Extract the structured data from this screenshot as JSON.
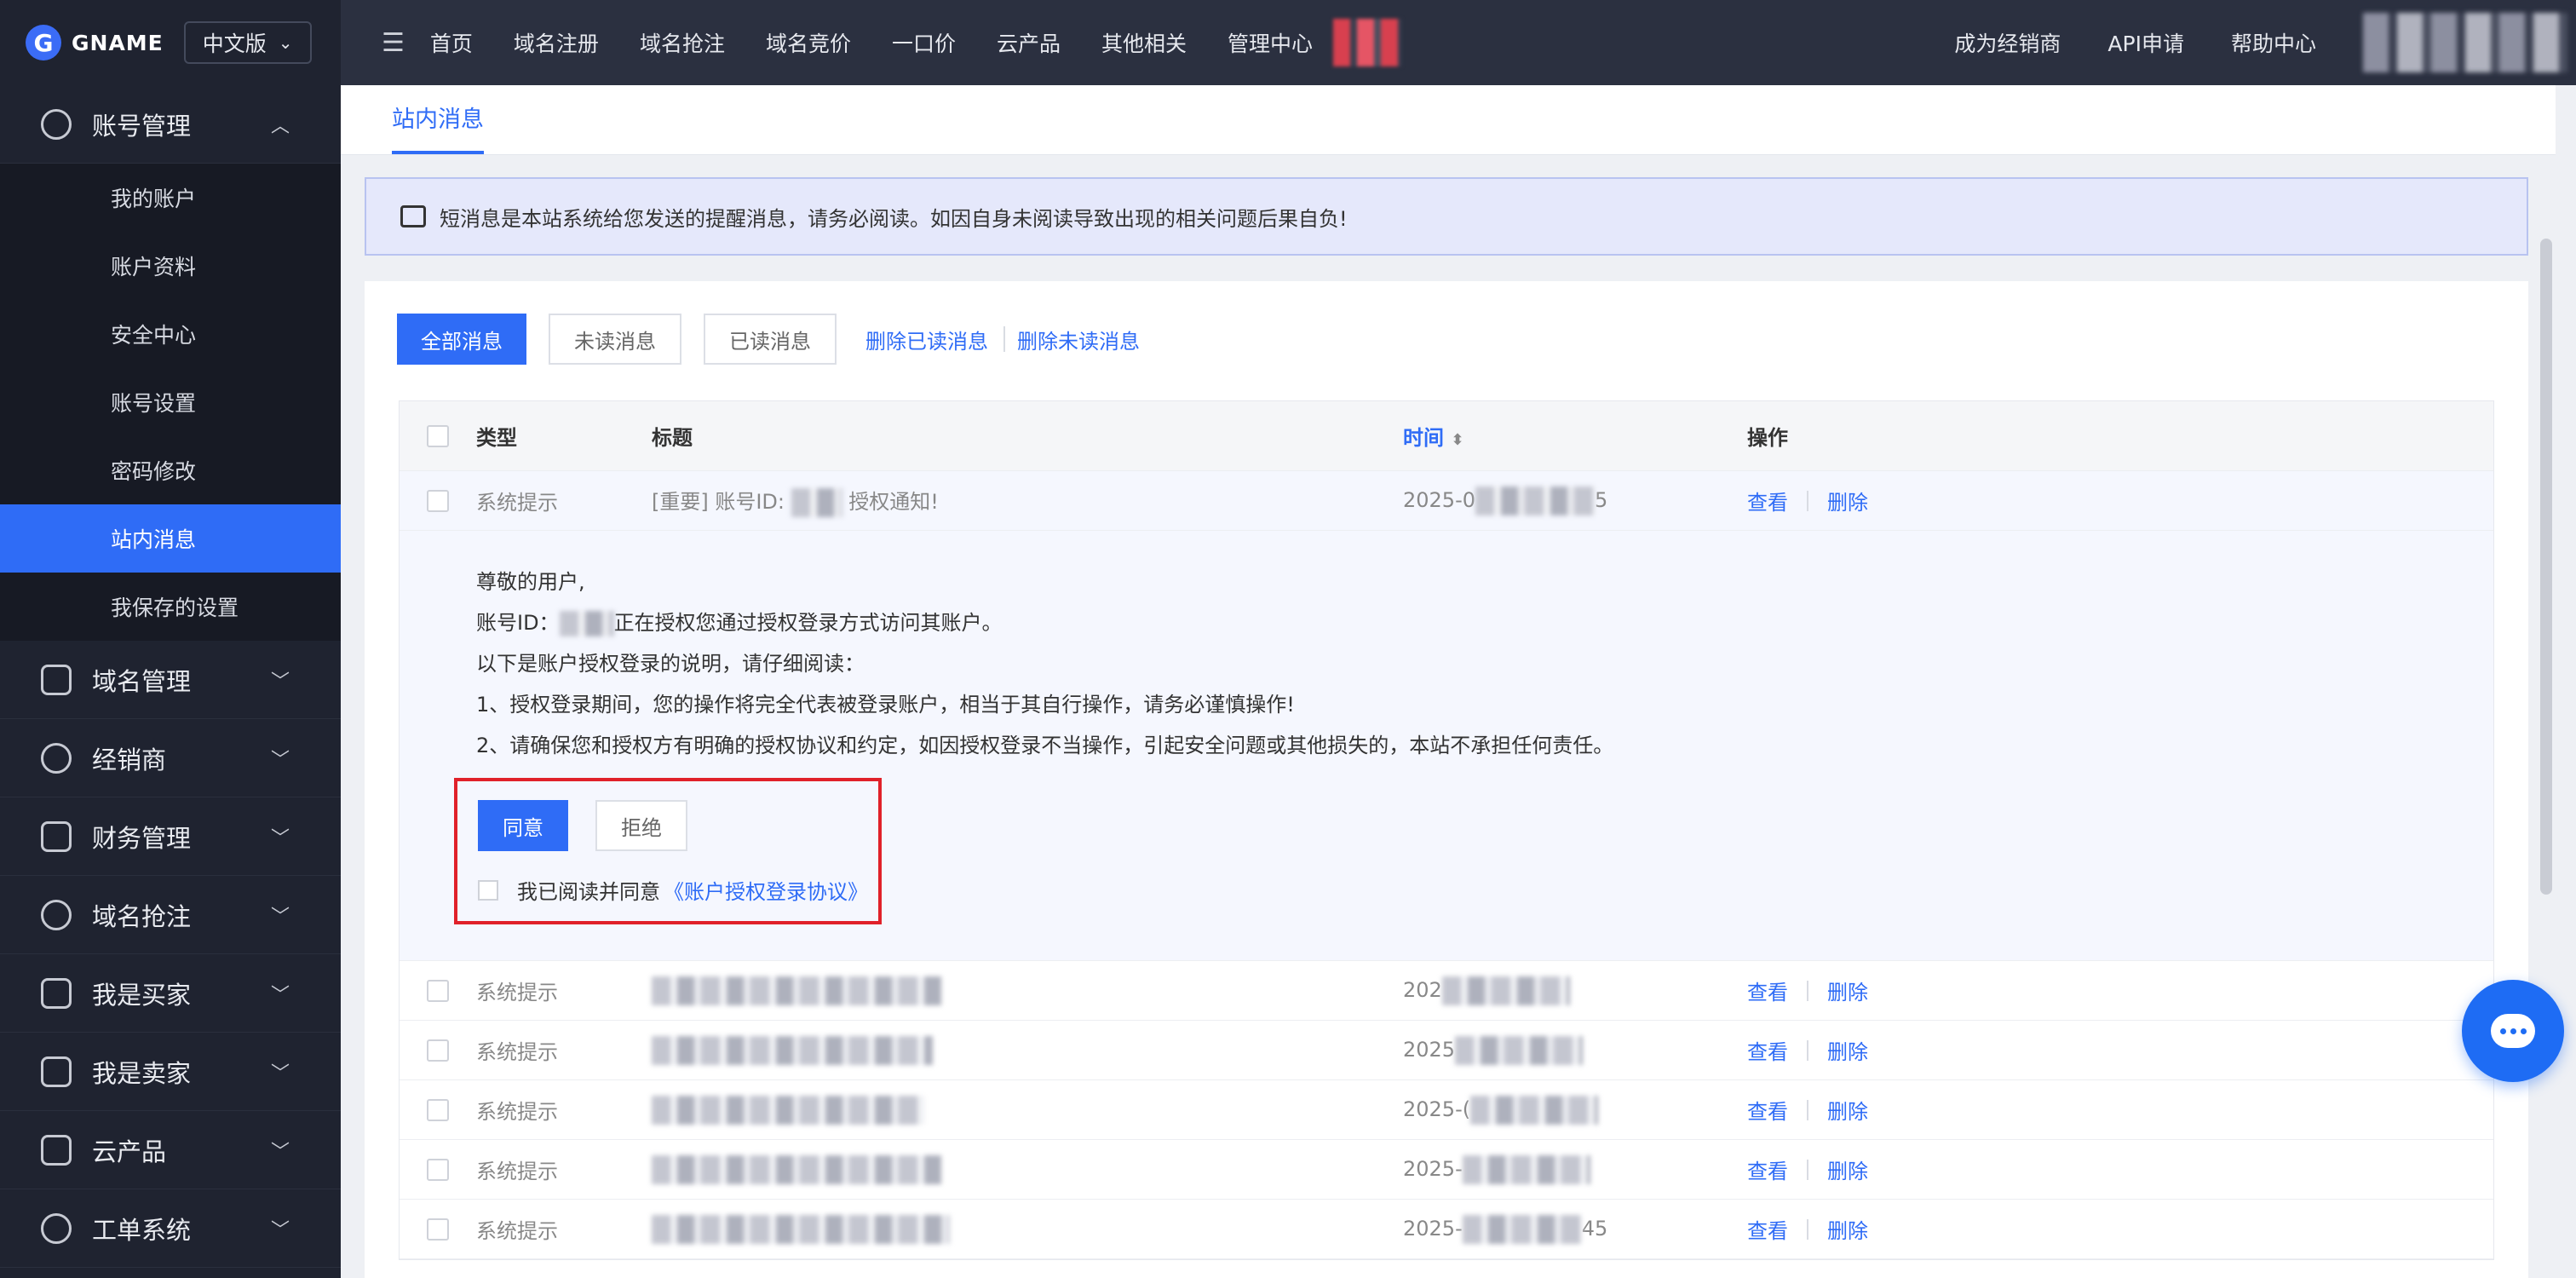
{
  "brand": {
    "logo_letter": "G",
    "name": "GNAME",
    "lang": "中文版"
  },
  "sidebar": {
    "groups": [
      {
        "label": "账号管理",
        "icon": "user-icon",
        "expanded": true
      },
      {
        "label": "域名管理",
        "icon": "layers-icon"
      },
      {
        "label": "经销商",
        "icon": "dealer-icon"
      },
      {
        "label": "财务管理",
        "icon": "finance-icon"
      },
      {
        "label": "域名抢注",
        "icon": "clock-icon"
      },
      {
        "label": "我是买家",
        "icon": "cart-icon"
      },
      {
        "label": "我是卖家",
        "icon": "store-icon"
      },
      {
        "label": "云产品",
        "icon": "cloud-icon"
      },
      {
        "label": "工单系统",
        "icon": "help-icon"
      }
    ],
    "sub_items": [
      {
        "label": "我的账户"
      },
      {
        "label": "账户资料"
      },
      {
        "label": "安全中心"
      },
      {
        "label": "账号设置"
      },
      {
        "label": "密码修改"
      },
      {
        "label": "站内消息",
        "active": true
      },
      {
        "label": "我保存的设置"
      }
    ]
  },
  "topnav": {
    "items": [
      "首页",
      "域名注册",
      "域名抢注",
      "域名竞价",
      "一口价",
      "云产品",
      "其他相关",
      "管理中心"
    ],
    "right": [
      "成为经销商",
      "API申请",
      "帮助中心"
    ]
  },
  "page": {
    "tab": "站内消息",
    "notice": "短消息是本站系统给您发送的提醒消息，请务必阅读。如因自身未阅读导致出现的相关问题后果自负!",
    "filters": {
      "all": "全部消息",
      "unread": "未读消息",
      "read": "已读消息",
      "delete_read": "删除已读消息",
      "delete_unread": "删除未读消息"
    },
    "table": {
      "headers": {
        "type": "类型",
        "title": "标题",
        "time": "时间",
        "action": "操作"
      },
      "first_row": {
        "type": "系统提示",
        "title": "[重要] 账号ID:",
        "title_suffix": "授权通知!",
        "time": "2025-0",
        "time_suffix": "5",
        "view": "查看",
        "delete": "删除"
      },
      "detail": {
        "greeting": "尊敬的用户,",
        "line1_prefix": "账号ID：",
        "line1_suffix": "正在授权您通过授权登录方式访问其账户。",
        "line2": "以下是账户授权登录的说明，请仔细阅读：",
        "line3": "1、授权登录期间，您的操作将完全代表被登录账户，相当于其自行操作，请务必谨慎操作!",
        "line4": "2、请确保您和授权方有明确的授权协议和约定，如因授权登录不当操作，引起安全问题或其他损失的，本站不承担任何责任。",
        "agree": "同意",
        "reject": "拒绝",
        "check_label": "我已阅读并同意",
        "agreement_link": "《账户授权登录协议》"
      },
      "rows": [
        {
          "type": "系统提示",
          "time": "202",
          "time_suffix": "",
          "view": "查看",
          "delete": "删除"
        },
        {
          "type": "系统提示",
          "time": "2025",
          "time_suffix": "",
          "view": "查看",
          "delete": "删除"
        },
        {
          "type": "系统提示",
          "time": "2025-(",
          "time_suffix": "",
          "view": "查看",
          "delete": "删除"
        },
        {
          "type": "系统提示",
          "time": "2025-",
          "time_suffix": "",
          "view": "查看",
          "delete": "删除"
        },
        {
          "type": "系统提示",
          "time": "2025-",
          "time_suffix": "45",
          "view": "查看",
          "delete": "删除"
        }
      ]
    }
  },
  "colors": {
    "primary": "#2f6cf6",
    "sidebar": "#1f2330",
    "topbar": "#2b3040",
    "highlight_box": "#e0212a"
  }
}
